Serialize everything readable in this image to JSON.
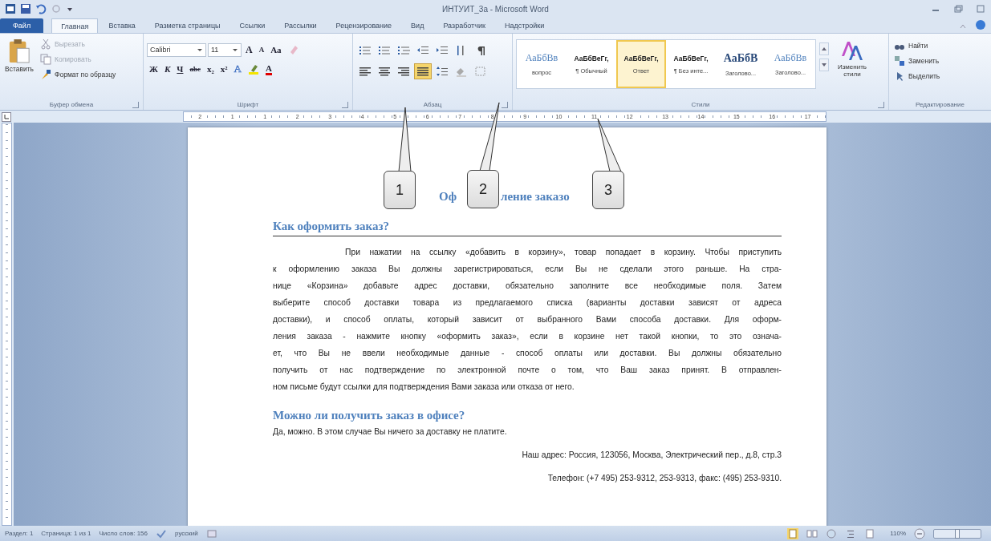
{
  "window": {
    "title": "ИНТУИТ_3а - Microsoft Word"
  },
  "tabs": [
    {
      "label": "Файл",
      "kind": "file",
      "selected": false
    },
    {
      "label": "Главная",
      "kind": "tab",
      "selected": true
    },
    {
      "label": "Вставка",
      "kind": "tab",
      "selected": false
    },
    {
      "label": "Разметка страницы",
      "kind": "tab",
      "selected": false
    },
    {
      "label": "Ссылки",
      "kind": "tab",
      "selected": false
    },
    {
      "label": "Рассылки",
      "kind": "tab",
      "selected": false
    },
    {
      "label": "Рецензирование",
      "kind": "tab",
      "selected": false
    },
    {
      "label": "Вид",
      "kind": "tab",
      "selected": false
    },
    {
      "label": "Разработчик",
      "kind": "tab",
      "selected": false
    },
    {
      "label": "Надстройки",
      "kind": "tab",
      "selected": false
    }
  ],
  "ribbon": {
    "clipboard": {
      "label": "Буфер обмена",
      "paste": "Вставить",
      "items": [
        {
          "label": "Вырезать",
          "kind": "cut",
          "disabled": true
        },
        {
          "label": "Копировать",
          "kind": "copy",
          "disabled": true
        },
        {
          "label": "Формат по образцу",
          "kind": "brush",
          "disabled": false
        }
      ]
    },
    "font": {
      "label": "Шрифт",
      "family": "Calibri",
      "size": "11",
      "row1": [
        {
          "label": "A",
          "kind": "grow"
        },
        {
          "label": "A",
          "kind": "shrink"
        },
        {
          "label": "Aa",
          "kind": "case"
        },
        {
          "kind": "clear"
        }
      ],
      "row2": [
        {
          "label": "Ж",
          "kind": "bold"
        },
        {
          "label": "К",
          "kind": "italic"
        },
        {
          "label": "Ч",
          "kind": "underline"
        },
        {
          "label": "abc",
          "kind": "strike"
        },
        {
          "label": "x₂",
          "kind": "sub"
        },
        {
          "label": "x²",
          "kind": "sup"
        },
        {
          "label": "A",
          "kind": "effects"
        },
        {
          "kind": "highlight"
        },
        {
          "label": "A",
          "kind": "color"
        }
      ]
    },
    "paragraph": {
      "label": "Абзац",
      "row1": [
        {
          "kind": "bullets",
          "selected": false
        },
        {
          "kind": "numbering",
          "selected": false
        },
        {
          "kind": "multilevel",
          "selected": false
        },
        {
          "kind": "outdent",
          "selected": false
        },
        {
          "kind": "indent",
          "selected": false
        },
        {
          "kind": "sort",
          "selected": false
        },
        {
          "kind": "pilcrow",
          "selected": false
        }
      ],
      "row2": [
        {
          "kind": "left",
          "selected": false
        },
        {
          "kind": "center",
          "selected": false
        },
        {
          "kind": "right",
          "selected": false
        },
        {
          "kind": "justify",
          "selected": true
        },
        {
          "kind": "spacing",
          "selected": false
        },
        {
          "kind": "shading",
          "selected": false
        },
        {
          "kind": "borders",
          "selected": false
        }
      ]
    },
    "styles": {
      "label": "Стили",
      "change": "Изменить стили",
      "items": [
        {
          "sample": "АаБбВв",
          "name": "вопрос",
          "kind": "serif",
          "selected": false
        },
        {
          "sample": "АаБбВеГг,",
          "name": "¶ Обычный",
          "kind": "sans",
          "selected": false
        },
        {
          "sample": "АаБбВеГг,",
          "name": "Ответ",
          "kind": "sans",
          "selected": true
        },
        {
          "sample": "АаБбВеГг,",
          "name": "¶ Без инте...",
          "kind": "sans",
          "selected": false
        },
        {
          "sample": "АаБбВ",
          "name": "Заголово...",
          "kind": "heading1",
          "selected": false
        },
        {
          "sample": "АаБбВв",
          "name": "Заголово...",
          "kind": "serif",
          "selected": false
        }
      ]
    },
    "editing": {
      "label": "Редактирование",
      "items": [
        {
          "label": "Найти",
          "kind": "find"
        },
        {
          "label": "Заменить",
          "kind": "replace"
        },
        {
          "label": "Выделить",
          "kind": "select"
        }
      ]
    }
  },
  "ruler": {
    "numbers": [
      "2",
      "1",
      "1",
      "2",
      "3",
      "4",
      "5",
      "6",
      "7",
      "8",
      "9",
      "10",
      "11",
      "12",
      "13",
      "14",
      "15",
      "16",
      "17"
    ]
  },
  "document": {
    "title_parts": [
      "Оф",
      "ление заказо"
    ],
    "heading1": "Как оформить заказ?",
    "paragraph_lines": [
      "При нажатии на ссылку «добавить в корзину», товар попадает в корзину. Чтобы приступить",
      "к оформлению заказа Вы должны зарегистрироваться, если Вы не сделали этого раньше. На стра-",
      "нице «Корзина» добавьте адрес доставки, обязательно заполните все необходимые поля. Затем",
      "выберите способ доставки товара из предлагаемого списка (варианты доставки зависят от адреса",
      "доставки), и способ оплаты, который зависит от выбранного Вами способа доставки. Для оформ-",
      "ления заказа - нажмите кнопку «оформить заказ», если в корзине нет такой кнопки, то это означа-",
      "ет, что Вы не ввели необходимые данные - способ оплаты или доставки. Вы должны обязательно",
      "получить от нас подтверждение по электронной почте о том, что Ваш заказ принят. В отправлен-",
      "ном письме будут ссылки для подтверждения Вами заказа или отказа от него."
    ],
    "heading2": "Можно ли получить заказ в офисе?",
    "answer": "Да, можно. В этом случае Вы ничего за доставку не платите.",
    "address": "Наш адрес: Россия, 123056, Москва, Электрический пер., д.8, стр.3",
    "phone": "Телефон: (+7 495) 253-9312, 253-9313, факс: (495) 253-9310."
  },
  "callouts": [
    {
      "label": "1"
    },
    {
      "label": "2"
    },
    {
      "label": "3"
    }
  ],
  "status_bar": {
    "section": "Раздел: 1",
    "page": "Страница: 1 из 1",
    "words": "Число слов: 156",
    "language": "русский",
    "zoom": "110%",
    "zoom_slider": {
      "level": 0.5
    }
  }
}
